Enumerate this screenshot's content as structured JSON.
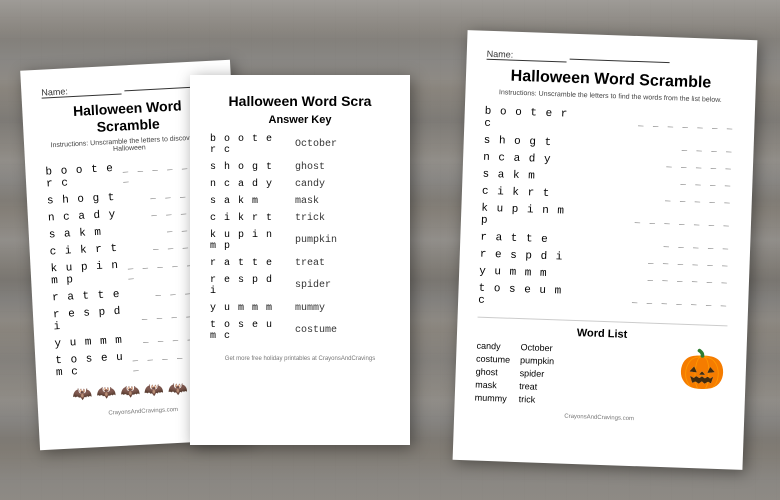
{
  "background": {
    "color": "#888888"
  },
  "worksheets": {
    "left": {
      "name_label": "Name:",
      "title": "Halloween Word Scramble",
      "instructions": "Instructions: Unscramble the letters to discover the Halloween",
      "scrambled_words": [
        {
          "word": "booter c",
          "dashes": "_ _ _ _ _ _ _"
        },
        {
          "word": "shogt",
          "dashes": "_ _ _ _ _"
        },
        {
          "word": "ncady",
          "dashes": "_ _ _ _ _"
        },
        {
          "word": "sakm",
          "dashes": "_ _ _ _"
        },
        {
          "word": "cikrt",
          "dashes": "_ _ _ _ _"
        },
        {
          "word": "kupinmp",
          "dashes": "_ _ _ _ _ _ _"
        },
        {
          "word": "ratte",
          "dashes": "_ _ _ _ _"
        },
        {
          "word": "respdi",
          "dashes": "_ _ _ _ _ _"
        },
        {
          "word": "yumm m",
          "dashes": "_ _ _ _ _ _"
        },
        {
          "word": "toseumc",
          "dashes": "_ _ _ _ _ _ _"
        }
      ],
      "bats": [
        "🦇",
        "🦇",
        "🦇",
        "🦇",
        "🦇"
      ],
      "footer": "CrayonsAndCravings.com"
    },
    "middle": {
      "title": "Halloween Word Scra",
      "section": "Answer Key",
      "answer_rows": [
        {
          "word": "booter c",
          "answer": "October"
        },
        {
          "word": "shogt",
          "answer": "ghost"
        },
        {
          "word": "ncady",
          "answer": "candy"
        },
        {
          "word": "sakm",
          "answer": "mask"
        },
        {
          "word": "cikrt",
          "answer": "trick"
        },
        {
          "word": "kupinm p",
          "answer": "pumpkin"
        },
        {
          "word": "ratte",
          "answer": "treat"
        },
        {
          "word": "r e s p d i",
          "answer": "spider"
        },
        {
          "word": "yumm m",
          "answer": "mummy"
        },
        {
          "word": "toseumc",
          "answer": "costume"
        }
      ],
      "footer": "Get more free holiday printables at CrayonsAndCravings"
    },
    "right": {
      "name_label": "Name:",
      "title": "Halloween Word Scramble",
      "instructions": "Instructions: Unscramble the letters to find the words from the list below.",
      "scrambled_words": [
        {
          "word": "booter c",
          "dashes": "_ _ _ _ _ _ _"
        },
        {
          "word": "shogt",
          "dashes": "_ _ _ _"
        },
        {
          "word": "ncady",
          "dashes": "_ _ _ _ _"
        },
        {
          "word": "sakm",
          "dashes": "_ _ _ _"
        },
        {
          "word": "cikrt",
          "dashes": "_ _ _ _ _"
        },
        {
          "word": "kupinm p",
          "dashes": "_ _ _ _ _ _ _"
        },
        {
          "word": "ratte",
          "dashes": "_ _ _ _ _"
        },
        {
          "word": "respdi",
          "dashes": "_ _ _ _ _ _"
        },
        {
          "word": "yumm m",
          "dashes": "_ _ _ _ _ _"
        },
        {
          "word": "toseumc",
          "dashes": "_ _ _ _ _ _ _"
        }
      ],
      "word_list_title": "Word List",
      "word_list_col1": [
        "candy",
        "costume",
        "ghost",
        "mask",
        "mummy"
      ],
      "word_list_col2": [
        "October",
        "pumpkin",
        "spider",
        "treat",
        "trick"
      ],
      "pumpkin_emoji": "🎃",
      "footer": "CrayonsAndCravings.com"
    }
  }
}
